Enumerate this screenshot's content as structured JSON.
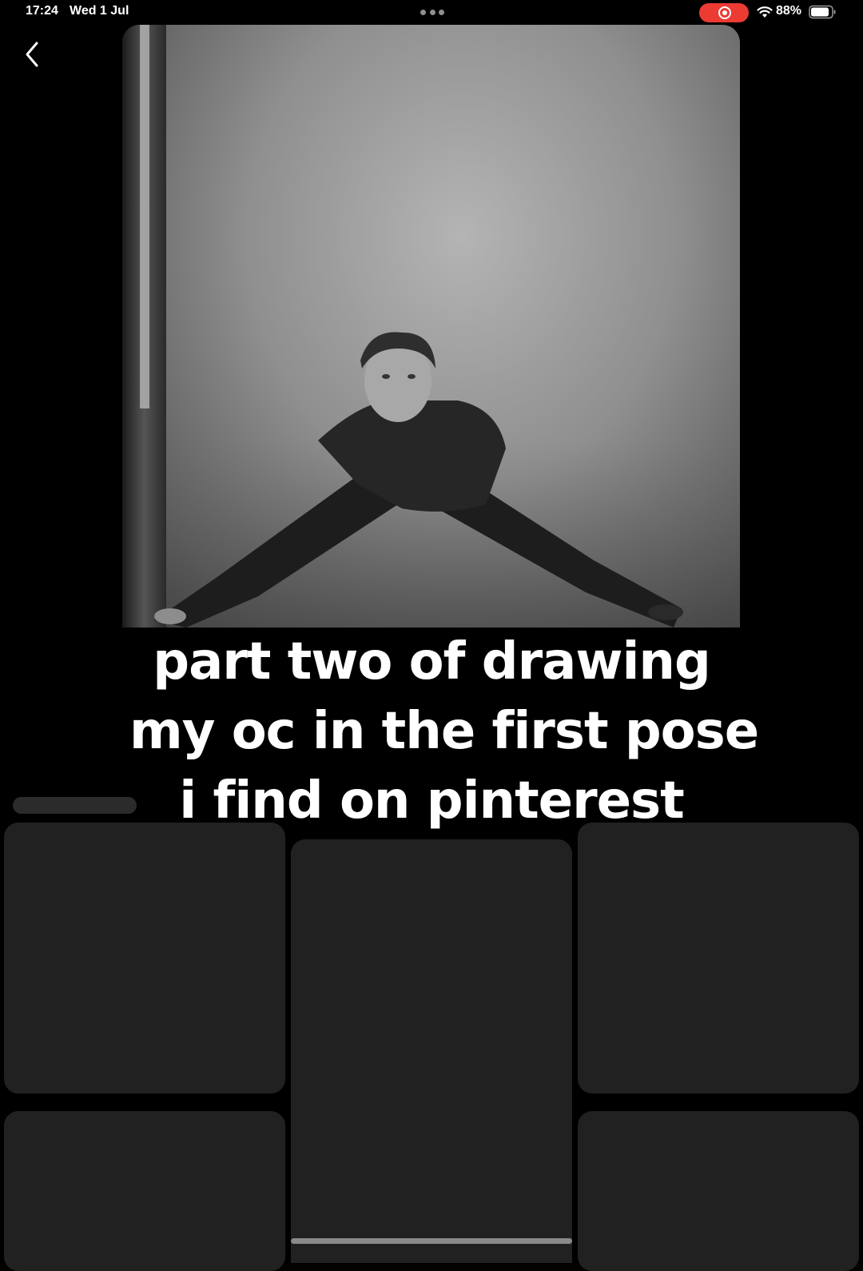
{
  "status_bar": {
    "time": "17:24",
    "date": "Wed 1 Jul",
    "battery_percent": "88%",
    "battery_level": 0.88,
    "recording_color": "#eb3b33",
    "icons": [
      "wifi-icon",
      "battery-icon",
      "screen-record-icon",
      "multitask-dots-icon"
    ]
  },
  "navigation": {
    "back_icon": "chevron-left-icon"
  },
  "pin": {
    "photo_description_icon": "photo-man-spread-legs-bw"
  },
  "caption": {
    "line1": "part two of drawing",
    "line2": "my oc in the first pose",
    "line3": "i find on pinterest"
  },
  "colors": {
    "background": "#000000",
    "tile": "#212121",
    "text": "#ffffff"
  }
}
